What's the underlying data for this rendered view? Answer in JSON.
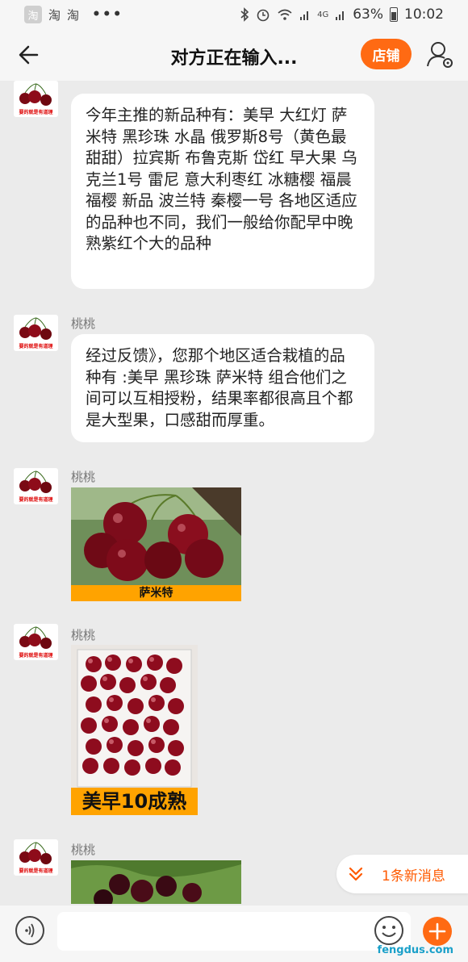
{
  "status_bar": {
    "app_badge": "淘",
    "apps": [
      "淘",
      "淘"
    ],
    "dots": "•••",
    "signal_label": "4G",
    "battery": "63%",
    "time": "10:02"
  },
  "header": {
    "title": "对方正在输入...",
    "store_button": "店铺"
  },
  "messages": [
    {
      "sender": "桃桃",
      "type": "text",
      "text": "今年主推的新品种有：美早 大红灯 萨米特 黑珍珠 水晶 俄罗斯8号（黄色最甜甜）拉宾斯 布鲁克斯 岱红 早大果 乌克兰1号 雷尼 意大利枣红 冰糖樱 福晨 福樱 新品 波兰特 秦樱一号 各地区适应的品种也不同，我们一般给你配早中晚熟紫红个大的品种"
    },
    {
      "sender": "桃桃",
      "type": "text",
      "text": "经过反馈》，您那个地区适合栽植的品种有 :美早 黑珍珠 萨米特 组合他们之间可以互相授粉，结果率都很高且个都是大型果，口感甜而厚重。"
    },
    {
      "sender": "桃桃",
      "type": "image",
      "caption": "萨米特"
    },
    {
      "sender": "桃桃",
      "type": "image",
      "caption": "美早10成熟"
    },
    {
      "sender": "桃桃",
      "type": "image",
      "caption": ""
    }
  ],
  "avatar_label": "要的就是有道理",
  "new_message_pill": "1条新消息",
  "input": {
    "placeholder": ""
  },
  "watermark": "fengdus.com",
  "colors": {
    "accent": "#ff6a13",
    "caption_bar": "#ffa300",
    "link": "#ff5a00"
  }
}
